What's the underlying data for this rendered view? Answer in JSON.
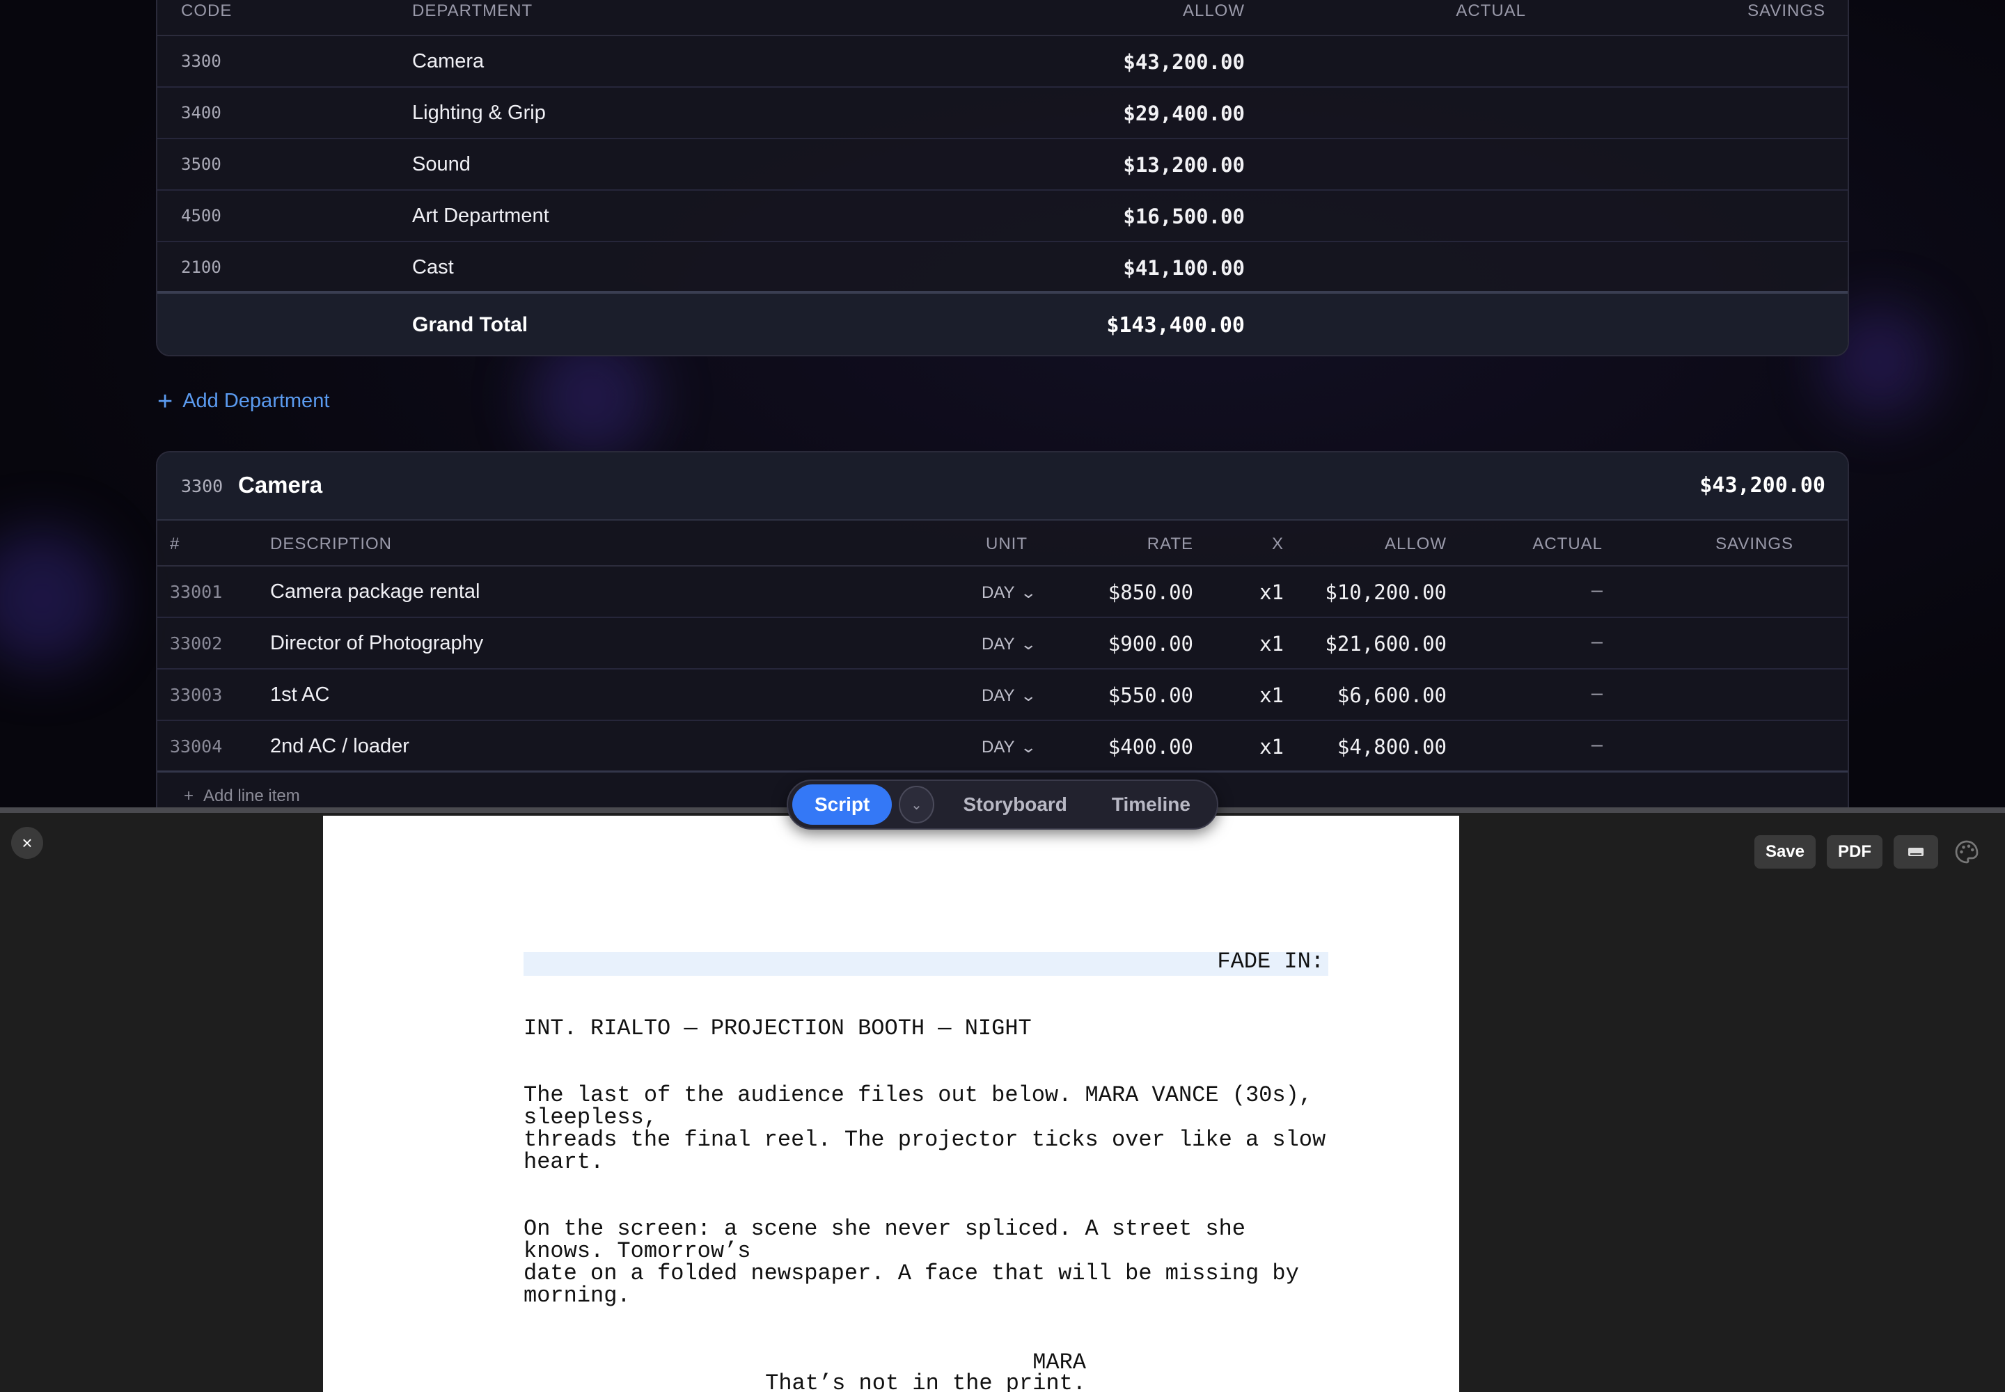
{
  "summary": {
    "headers": {
      "code": "CODE",
      "department": "DEPARTMENT",
      "allow": "ALLOW",
      "actual": "ACTUAL",
      "savings": "SAVINGS"
    },
    "rows": [
      {
        "code": "3300",
        "department": "Camera",
        "allow": "$43,200.00"
      },
      {
        "code": "3400",
        "department": "Lighting & Grip",
        "allow": "$29,400.00"
      },
      {
        "code": "3500",
        "department": "Sound",
        "allow": "$13,200.00"
      },
      {
        "code": "4500",
        "department": "Art Department",
        "allow": "$16,500.00"
      },
      {
        "code": "2100",
        "department": "Cast",
        "allow": "$41,100.00"
      }
    ],
    "grand_total_label": "Grand Total",
    "grand_total_value": "$143,400.00"
  },
  "add_department": "Add Department",
  "camera": {
    "code": "3300",
    "name": "Camera",
    "total": "$43,200.00",
    "headers": {
      "num": "#",
      "description": "DESCRIPTION",
      "unit": "UNIT",
      "rate": "RATE",
      "x": "X",
      "allow": "ALLOW",
      "actual": "ACTUAL",
      "savings": "SAVINGS"
    },
    "items": [
      {
        "num": "33001",
        "description": "Camera package rental",
        "unit": "DAY",
        "rate": "$850.00",
        "x": "x1",
        "allow": "$10,200.00",
        "actual": "–"
      },
      {
        "num": "33002",
        "description": "Director of Photography",
        "unit": "DAY",
        "rate": "$900.00",
        "x": "x1",
        "allow": "$21,600.00",
        "actual": "–"
      },
      {
        "num": "33003",
        "description": "1st AC",
        "unit": "DAY",
        "rate": "$550.00",
        "x": "x1",
        "allow": "$6,600.00",
        "actual": "–"
      },
      {
        "num": "33004",
        "description": "2nd AC / loader",
        "unit": "DAY",
        "rate": "$400.00",
        "x": "x1",
        "allow": "$4,800.00",
        "actual": "–"
      }
    ],
    "add_line_item": "Add line item"
  },
  "viewbar": {
    "script": "Script",
    "storyboard": "Storyboard",
    "timeline": "Timeline"
  },
  "toolbar": {
    "save": "Save",
    "pdf": "PDF"
  },
  "close_label": "×",
  "script": {
    "transition": "FADE IN:",
    "scene_heading": "INT. RIALTO — PROJECTION BOOTH — NIGHT",
    "action1": [
      "The last of the audience files out below. MARA VANCE (30s),",
      "sleepless,",
      "threads the final reel. The projector ticks over like a slow",
      "heart."
    ],
    "action2": [
      "On the screen: a scene she never spliced. A street she",
      "knows. Tomorrow’s",
      "date on a folded newspaper. A face that will be missing by",
      "morning."
    ],
    "character": "MARA",
    "dialogue": "That’s not in the print."
  }
}
